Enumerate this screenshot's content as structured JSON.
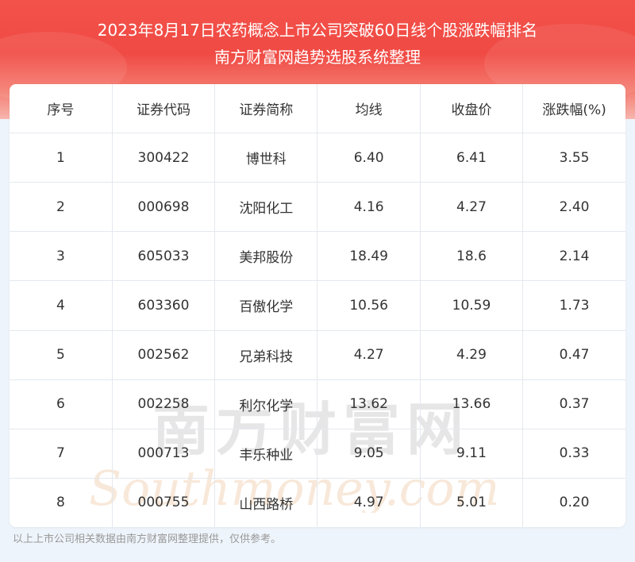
{
  "header": {
    "title_line1": "2023年8月17日农药概念上市公司突破60日线个股涨跌幅排名",
    "title_line2": "南方财富网趋势选股系统整理"
  },
  "table": {
    "columns": [
      "序号",
      "证券代码",
      "证券简称",
      "均线",
      "收盘价",
      "涨跌幅(%)"
    ],
    "rows": [
      [
        "1",
        "300422",
        "博世科",
        "6.40",
        "6.41",
        "3.55"
      ],
      [
        "2",
        "000698",
        "沈阳化工",
        "4.16",
        "4.27",
        "2.40"
      ],
      [
        "3",
        "605033",
        "美邦股份",
        "18.49",
        "18.6",
        "2.14"
      ],
      [
        "4",
        "603360",
        "百傲化学",
        "10.56",
        "10.59",
        "1.73"
      ],
      [
        "5",
        "002562",
        "兄弟科技",
        "4.27",
        "4.29",
        "0.47"
      ],
      [
        "6",
        "002258",
        "利尔化学",
        "13.62",
        "13.66",
        "0.37"
      ],
      [
        "7",
        "000713",
        "丰乐种业",
        "9.05",
        "9.11",
        "0.33"
      ],
      [
        "8",
        "000755",
        "山西路桥",
        "4.97",
        "5.01",
        "0.20"
      ]
    ]
  },
  "watermark": {
    "cn": "南方财富网",
    "en": "Southmoney.com"
  },
  "footer": {
    "note": "以上上市公司相关数据由南方财富网整理提供，仅供参考。"
  },
  "colors": {
    "header_red": "#f04a44",
    "background": "#eef4fb"
  }
}
